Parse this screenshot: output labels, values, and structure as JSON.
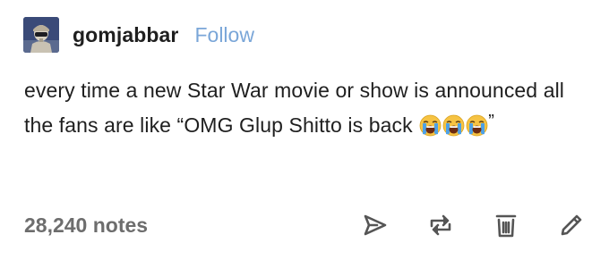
{
  "post": {
    "username": "gomjabbar",
    "follow_label": "Follow",
    "avatar_icon": "helmeted-figure-avatar",
    "body_text": "every time a new Star War movie or show is announced all the fans are like “OMG Glup Shitto is back",
    "emojis": [
      "loudly-crying-face",
      "loudly-crying-face",
      "loudly-crying-face"
    ],
    "closing_quote": "”",
    "notes_label": "28,240 notes",
    "actions": [
      "share-icon",
      "reblog-icon",
      "delete-icon",
      "edit-icon"
    ]
  },
  "colors": {
    "follow": "#7aa6d8",
    "text": "#1f1f1f",
    "notes": "#6d6d6d",
    "icons": "#555555",
    "emoji_face": "#f6c343",
    "emoji_tears": "#4ea1e6"
  }
}
